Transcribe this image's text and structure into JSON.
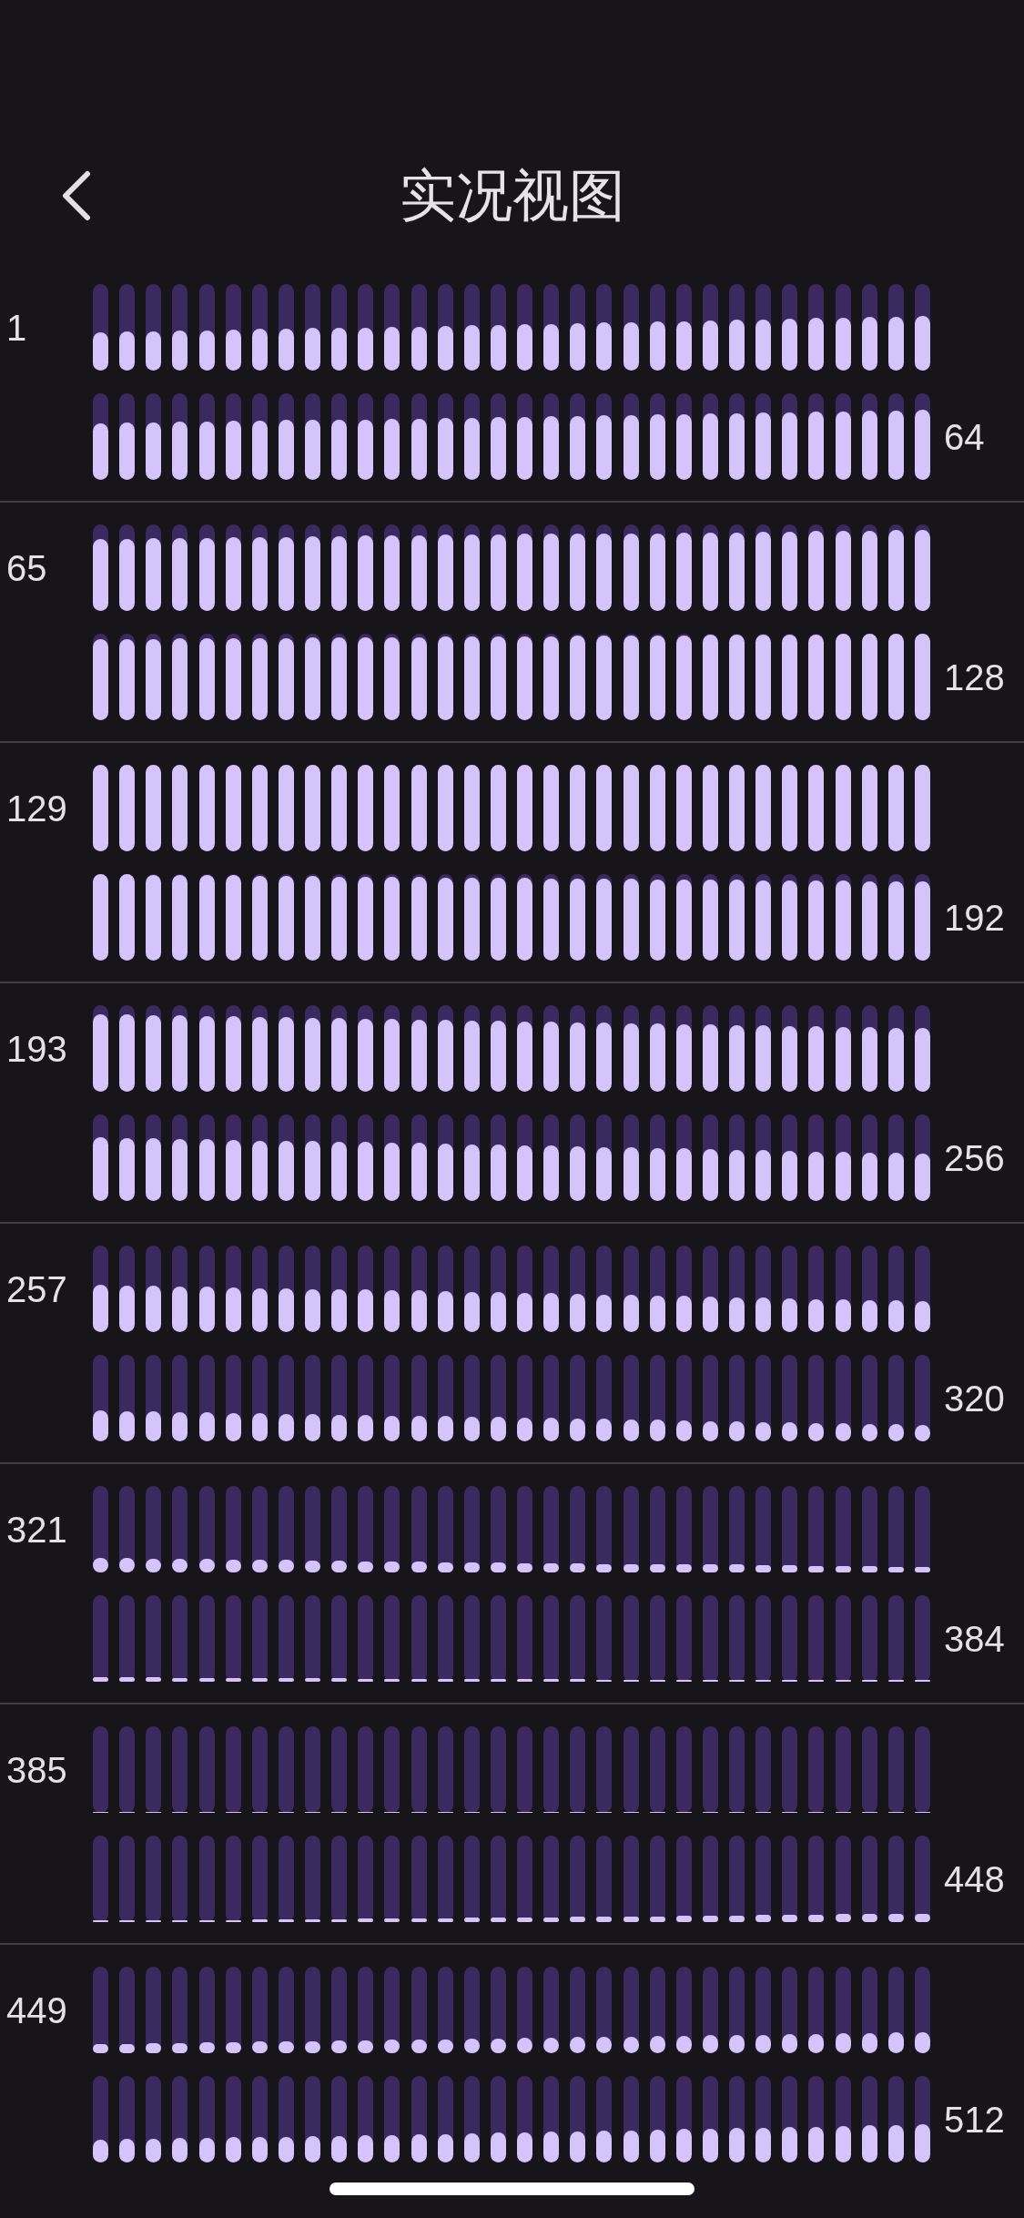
{
  "header": {
    "title": "实况视图"
  },
  "groups": [
    {
      "start": "1",
      "end": "64",
      "rows": [
        {
          "meters": [
            {
              "level": 0.44
            },
            {
              "level": 0.45
            },
            {
              "level": 0.45
            },
            {
              "level": 0.46
            },
            {
              "level": 0.46
            },
            {
              "level": 0.47
            },
            {
              "level": 0.48
            },
            {
              "level": 0.48
            },
            {
              "level": 0.49
            },
            {
              "level": 0.5
            },
            {
              "level": 0.5
            },
            {
              "level": 0.51
            },
            {
              "level": 0.51
            },
            {
              "level": 0.52
            },
            {
              "level": 0.53
            },
            {
              "level": 0.53
            },
            {
              "level": 0.54
            },
            {
              "level": 0.54
            },
            {
              "level": 0.55
            },
            {
              "level": 0.56
            },
            {
              "level": 0.56
            },
            {
              "level": 0.57
            },
            {
              "level": 0.57
            },
            {
              "level": 0.58
            },
            {
              "level": 0.59
            },
            {
              "level": 0.59
            },
            {
              "level": 0.6
            },
            {
              "level": 0.61
            },
            {
              "level": 0.61
            },
            {
              "level": 0.62
            },
            {
              "level": 0.62
            },
            {
              "level": 0.63
            }
          ]
        },
        {
          "meters": [
            {
              "level": 0.65
            },
            {
              "level": 0.66
            },
            {
              "level": 0.66
            },
            {
              "level": 0.67
            },
            {
              "level": 0.67
            },
            {
              "level": 0.68
            },
            {
              "level": 0.68
            },
            {
              "level": 0.69
            },
            {
              "level": 0.69
            },
            {
              "level": 0.7
            },
            {
              "level": 0.7
            },
            {
              "level": 0.71
            },
            {
              "level": 0.71
            },
            {
              "level": 0.72
            },
            {
              "level": 0.72
            },
            {
              "level": 0.73
            },
            {
              "level": 0.73
            },
            {
              "level": 0.74
            },
            {
              "level": 0.74
            },
            {
              "level": 0.75
            },
            {
              "level": 0.75
            },
            {
              "level": 0.76
            },
            {
              "level": 0.76
            },
            {
              "level": 0.77
            },
            {
              "level": 0.77
            },
            {
              "level": 0.78
            },
            {
              "level": 0.78
            },
            {
              "level": 0.79
            },
            {
              "level": 0.79
            },
            {
              "level": 0.8
            },
            {
              "level": 0.8
            },
            {
              "level": 0.81
            }
          ]
        }
      ]
    },
    {
      "start": "65",
      "end": "128",
      "rows": [
        {
          "meters": [
            {
              "level": 0.83
            },
            {
              "level": 0.83
            },
            {
              "level": 0.84
            },
            {
              "level": 0.84
            },
            {
              "level": 0.84
            },
            {
              "level": 0.85
            },
            {
              "level": 0.85
            },
            {
              "level": 0.85
            },
            {
              "level": 0.86
            },
            {
              "level": 0.86
            },
            {
              "level": 0.87
            },
            {
              "level": 0.87
            },
            {
              "level": 0.87
            },
            {
              "level": 0.88
            },
            {
              "level": 0.88
            },
            {
              "level": 0.88
            },
            {
              "level": 0.89
            },
            {
              "level": 0.89
            },
            {
              "level": 0.89
            },
            {
              "level": 0.9
            },
            {
              "level": 0.9
            },
            {
              "level": 0.9
            },
            {
              "level": 0.91
            },
            {
              "level": 0.91
            },
            {
              "level": 0.91
            },
            {
              "level": 0.92
            },
            {
              "level": 0.92
            },
            {
              "level": 0.93
            },
            {
              "level": 0.93
            },
            {
              "level": 0.93
            },
            {
              "level": 0.94
            },
            {
              "level": 0.94
            }
          ]
        },
        {
          "meters": [
            {
              "level": 0.94
            },
            {
              "level": 0.94
            },
            {
              "level": 0.94
            },
            {
              "level": 0.95
            },
            {
              "level": 0.95
            },
            {
              "level": 0.95
            },
            {
              "level": 0.95
            },
            {
              "level": 0.95
            },
            {
              "level": 0.96
            },
            {
              "level": 0.96
            },
            {
              "level": 0.96
            },
            {
              "level": 0.96
            },
            {
              "level": 0.96
            },
            {
              "level": 0.97
            },
            {
              "level": 0.97
            },
            {
              "level": 0.97
            },
            {
              "level": 0.97
            },
            {
              "level": 0.97
            },
            {
              "level": 0.98
            },
            {
              "level": 0.98
            },
            {
              "level": 0.98
            },
            {
              "level": 0.98
            },
            {
              "level": 0.98
            },
            {
              "level": 0.99
            },
            {
              "level": 0.99
            },
            {
              "level": 0.99
            },
            {
              "level": 0.99
            },
            {
              "level": 0.99
            },
            {
              "level": 1
            },
            {
              "level": 1
            },
            {
              "level": 1
            },
            {
              "level": 1
            }
          ]
        }
      ]
    },
    {
      "start": "129",
      "end": "192",
      "rows": [
        {
          "meters": [
            {
              "level": 1
            },
            {
              "level": 1
            },
            {
              "level": 1
            },
            {
              "level": 1
            },
            {
              "level": 1
            },
            {
              "level": 1
            },
            {
              "level": 1
            },
            {
              "level": 1
            },
            {
              "level": 1
            },
            {
              "level": 1
            },
            {
              "level": 1
            },
            {
              "level": 1
            },
            {
              "level": 1
            },
            {
              "level": 1
            },
            {
              "level": 1
            },
            {
              "level": 1
            },
            {
              "level": 1
            },
            {
              "level": 1
            },
            {
              "level": 1
            },
            {
              "level": 1
            },
            {
              "level": 1
            },
            {
              "level": 1
            },
            {
              "level": 1
            },
            {
              "level": 1
            },
            {
              "level": 1
            },
            {
              "level": 1
            },
            {
              "level": 1
            },
            {
              "level": 1
            },
            {
              "level": 1
            },
            {
              "level": 1
            },
            {
              "level": 1
            },
            {
              "level": 1
            }
          ]
        },
        {
          "meters": [
            {
              "level": 1
            },
            {
              "level": 1
            },
            {
              "level": 0.99
            },
            {
              "level": 0.99
            },
            {
              "level": 0.99
            },
            {
              "level": 0.99
            },
            {
              "level": 0.98
            },
            {
              "level": 0.98
            },
            {
              "level": 0.98
            },
            {
              "level": 0.97
            },
            {
              "level": 0.97
            },
            {
              "level": 0.97
            },
            {
              "level": 0.97
            },
            {
              "level": 0.96
            },
            {
              "level": 0.96
            },
            {
              "level": 0.96
            },
            {
              "level": 0.96
            },
            {
              "level": 0.95
            },
            {
              "level": 0.95
            },
            {
              "level": 0.95
            },
            {
              "level": 0.95
            },
            {
              "level": 0.94
            },
            {
              "level": 0.94
            },
            {
              "level": 0.94
            },
            {
              "level": 0.94
            },
            {
              "level": 0.93
            },
            {
              "level": 0.93
            },
            {
              "level": 0.93
            },
            {
              "level": 0.93
            },
            {
              "level": 0.92
            },
            {
              "level": 0.92
            },
            {
              "level": 0.92
            }
          ]
        }
      ]
    },
    {
      "start": "193",
      "end": "256",
      "rows": [
        {
          "meters": [
            {
              "level": 0.89
            },
            {
              "level": 0.89
            },
            {
              "level": 0.88
            },
            {
              "level": 0.88
            },
            {
              "level": 0.87
            },
            {
              "level": 0.87
            },
            {
              "level": 0.86
            },
            {
              "level": 0.86
            },
            {
              "level": 0.85
            },
            {
              "level": 0.85
            },
            {
              "level": 0.84
            },
            {
              "level": 0.84
            },
            {
              "level": 0.83
            },
            {
              "level": 0.83
            },
            {
              "level": 0.82
            },
            {
              "level": 0.82
            },
            {
              "level": 0.81
            },
            {
              "level": 0.81
            },
            {
              "level": 0.8
            },
            {
              "level": 0.8
            },
            {
              "level": 0.79
            },
            {
              "level": 0.79
            },
            {
              "level": 0.78
            },
            {
              "level": 0.78
            },
            {
              "level": 0.77
            },
            {
              "level": 0.77
            },
            {
              "level": 0.76
            },
            {
              "level": 0.76
            },
            {
              "level": 0.75
            },
            {
              "level": 0.75
            },
            {
              "level": 0.74
            },
            {
              "level": 0.74
            }
          ]
        },
        {
          "meters": [
            {
              "level": 0.74
            },
            {
              "level": 0.73
            },
            {
              "level": 0.73
            },
            {
              "level": 0.72
            },
            {
              "level": 0.72
            },
            {
              "level": 0.71
            },
            {
              "level": 0.7
            },
            {
              "level": 0.7
            },
            {
              "level": 0.69
            },
            {
              "level": 0.68
            },
            {
              "level": 0.68
            },
            {
              "level": 0.67
            },
            {
              "level": 0.67
            },
            {
              "level": 0.66
            },
            {
              "level": 0.65
            },
            {
              "level": 0.65
            },
            {
              "level": 0.64
            },
            {
              "level": 0.64
            },
            {
              "level": 0.63
            },
            {
              "level": 0.62
            },
            {
              "level": 0.62
            },
            {
              "level": 0.61
            },
            {
              "level": 0.61
            },
            {
              "level": 0.6
            },
            {
              "level": 0.59
            },
            {
              "level": 0.59
            },
            {
              "level": 0.58
            },
            {
              "level": 0.57
            },
            {
              "level": 0.57
            },
            {
              "level": 0.56
            },
            {
              "level": 0.56
            },
            {
              "level": 0.55
            }
          ]
        }
      ]
    },
    {
      "start": "257",
      "end": "320",
      "rows": [
        {
          "meters": [
            {
              "level": 0.55
            },
            {
              "level": 0.54
            },
            {
              "level": 0.54
            },
            {
              "level": 0.53
            },
            {
              "level": 0.53
            },
            {
              "level": 0.52
            },
            {
              "level": 0.51
            },
            {
              "level": 0.51
            },
            {
              "level": 0.5
            },
            {
              "level": 0.49
            },
            {
              "level": 0.49
            },
            {
              "level": 0.48
            },
            {
              "level": 0.48
            },
            {
              "level": 0.47
            },
            {
              "level": 0.46
            },
            {
              "level": 0.46
            },
            {
              "level": 0.45
            },
            {
              "level": 0.45
            },
            {
              "level": 0.44
            },
            {
              "level": 0.43
            },
            {
              "level": 0.43
            },
            {
              "level": 0.42
            },
            {
              "level": 0.42
            },
            {
              "level": 0.41
            },
            {
              "level": 0.4
            },
            {
              "level": 0.4
            },
            {
              "level": 0.39
            },
            {
              "level": 0.38
            },
            {
              "level": 0.38
            },
            {
              "level": 0.37
            },
            {
              "level": 0.37
            },
            {
              "level": 0.36
            }
          ]
        },
        {
          "meters": [
            {
              "level": 0.36
            },
            {
              "level": 0.35
            },
            {
              "level": 0.35
            },
            {
              "level": 0.34
            },
            {
              "level": 0.34
            },
            {
              "level": 0.33
            },
            {
              "level": 0.33
            },
            {
              "level": 0.32
            },
            {
              "level": 0.32
            },
            {
              "level": 0.31
            },
            {
              "level": 0.31
            },
            {
              "level": 0.3
            },
            {
              "level": 0.29
            },
            {
              "level": 0.29
            },
            {
              "level": 0.28
            },
            {
              "level": 0.28
            },
            {
              "level": 0.27
            },
            {
              "level": 0.27
            },
            {
              "level": 0.26
            },
            {
              "level": 0.26
            },
            {
              "level": 0.25
            },
            {
              "level": 0.25
            },
            {
              "level": 0.24
            },
            {
              "level": 0.23
            },
            {
              "level": 0.23
            },
            {
              "level": 0.22
            },
            {
              "level": 0.22
            },
            {
              "level": 0.21
            },
            {
              "level": 0.21
            },
            {
              "level": 0.2
            },
            {
              "level": 0.2
            },
            {
              "level": 0.19
            }
          ]
        }
      ]
    },
    {
      "start": "321",
      "end": "384",
      "rows": [
        {
          "meters": [
            {
              "level": 0.17
            },
            {
              "level": 0.17
            },
            {
              "level": 0.16
            },
            {
              "level": 0.16
            },
            {
              "level": 0.16
            },
            {
              "level": 0.15
            },
            {
              "level": 0.15
            },
            {
              "level": 0.15
            },
            {
              "level": 0.14
            },
            {
              "level": 0.14
            },
            {
              "level": 0.13
            },
            {
              "level": 0.13
            },
            {
              "level": 0.13
            },
            {
              "level": 0.12
            },
            {
              "level": 0.12
            },
            {
              "level": 0.12
            },
            {
              "level": 0.11
            },
            {
              "level": 0.11
            },
            {
              "level": 0.11
            },
            {
              "level": 0.1
            },
            {
              "level": 0.1
            },
            {
              "level": 0.1
            },
            {
              "level": 0.09
            },
            {
              "level": 0.09
            },
            {
              "level": 0.09
            },
            {
              "level": 0.08
            },
            {
              "level": 0.08
            },
            {
              "level": 0.07
            },
            {
              "level": 0.07
            },
            {
              "level": 0.07
            },
            {
              "level": 0.06
            },
            {
              "level": 0.06
            }
          ]
        },
        {
          "meters": [
            {
              "level": 0.05
            },
            {
              "level": 0.05
            },
            {
              "level": 0.05
            },
            {
              "level": 0.045
            },
            {
              "level": 0.045
            },
            {
              "level": 0.045
            },
            {
              "level": 0.04
            },
            {
              "level": 0.04
            },
            {
              "level": 0.04
            },
            {
              "level": 0.04
            },
            {
              "level": 0.035
            },
            {
              "level": 0.035
            },
            {
              "level": 0.035
            },
            {
              "level": 0.035
            },
            {
              "level": 0.03
            },
            {
              "level": 0.03
            },
            {
              "level": 0.03
            },
            {
              "level": 0.03
            },
            {
              "level": 0.03
            },
            {
              "level": 0.025
            },
            {
              "level": 0.025
            },
            {
              "level": 0.025
            },
            {
              "level": 0.025
            },
            {
              "level": 0.025
            },
            {
              "level": 0.025
            },
            {
              "level": 0.02
            },
            {
              "level": 0.02
            },
            {
              "level": 0.02
            },
            {
              "level": 0.02
            },
            {
              "level": 0.02
            },
            {
              "level": 0.02
            },
            {
              "level": 0.02
            }
          ]
        }
      ]
    },
    {
      "start": "385",
      "end": "448",
      "rows": [
        {
          "meters": [
            {
              "level": 0
            },
            {
              "level": 0
            },
            {
              "level": 0
            },
            {
              "level": 0
            },
            {
              "level": 0
            },
            {
              "level": 0
            },
            {
              "level": 0
            },
            {
              "level": 0
            },
            {
              "level": 0
            },
            {
              "level": 0
            },
            {
              "level": 0
            },
            {
              "level": 0
            },
            {
              "level": 0
            },
            {
              "level": 0
            },
            {
              "level": 0
            },
            {
              "level": 0
            },
            {
              "level": 0
            },
            {
              "level": 0
            },
            {
              "level": 0
            },
            {
              "level": 0
            },
            {
              "level": 0.015
            },
            {
              "level": 0.015
            },
            {
              "level": 0.015
            },
            {
              "level": 0.015
            },
            {
              "level": 0.015
            },
            {
              "level": 0.015
            },
            {
              "level": 0.015
            },
            {
              "level": 0.015
            },
            {
              "level": 0.015
            },
            {
              "level": 0.015
            },
            {
              "level": 0.015
            },
            {
              "level": 0.015
            }
          ]
        },
        {
          "meters": [
            {
              "level": 0.02
            },
            {
              "level": 0.02
            },
            {
              "level": 0.02
            },
            {
              "level": 0.025
            },
            {
              "level": 0.025
            },
            {
              "level": 0.025
            },
            {
              "level": 0.03
            },
            {
              "level": 0.03
            },
            {
              "level": 0.035
            },
            {
              "level": 0.035
            },
            {
              "level": 0.04
            },
            {
              "level": 0.04
            },
            {
              "level": 0.045
            },
            {
              "level": 0.045
            },
            {
              "level": 0.05
            },
            {
              "level": 0.05
            },
            {
              "level": 0.055
            },
            {
              "level": 0.055
            },
            {
              "level": 0.06
            },
            {
              "level": 0.06
            },
            {
              "level": 0.065
            },
            {
              "level": 0.065
            },
            {
              "level": 0.07
            },
            {
              "level": 0.07
            },
            {
              "level": 0.075
            },
            {
              "level": 0.08
            },
            {
              "level": 0.08
            },
            {
              "level": 0.085
            },
            {
              "level": 0.09
            },
            {
              "level": 0.09
            },
            {
              "level": 0.095
            },
            {
              "level": 0.1
            }
          ]
        }
      ]
    },
    {
      "start": "449",
      "end": "512",
      "rows": [
        {
          "meters": [
            {
              "level": 0.11
            },
            {
              "level": 0.11
            },
            {
              "level": 0.12
            },
            {
              "level": 0.12
            },
            {
              "level": 0.13
            },
            {
              "level": 0.13
            },
            {
              "level": 0.14
            },
            {
              "level": 0.14
            },
            {
              "level": 0.14
            },
            {
              "level": 0.15
            },
            {
              "level": 0.15
            },
            {
              "level": 0.16
            },
            {
              "level": 0.16
            },
            {
              "level": 0.16
            },
            {
              "level": 0.17
            },
            {
              "level": 0.17
            },
            {
              "level": 0.18
            },
            {
              "level": 0.18
            },
            {
              "level": 0.19
            },
            {
              "level": 0.19
            },
            {
              "level": 0.19
            },
            {
              "level": 0.2
            },
            {
              "level": 0.2
            },
            {
              "level": 0.21
            },
            {
              "level": 0.21
            },
            {
              "level": 0.21
            },
            {
              "level": 0.22
            },
            {
              "level": 0.22
            },
            {
              "level": 0.23
            },
            {
              "level": 0.23
            },
            {
              "level": 0.24
            },
            {
              "level": 0.24
            }
          ]
        },
        {
          "meters": [
            {
              "level": 0.26
            },
            {
              "level": 0.27
            },
            {
              "level": 0.27
            },
            {
              "level": 0.28
            },
            {
              "level": 0.28
            },
            {
              "level": 0.29
            },
            {
              "level": 0.29
            },
            {
              "level": 0.3
            },
            {
              "level": 0.31
            },
            {
              "level": 0.31
            },
            {
              "level": 0.32
            },
            {
              "level": 0.32
            },
            {
              "level": 0.33
            },
            {
              "level": 0.33
            },
            {
              "level": 0.34
            },
            {
              "level": 0.35
            },
            {
              "level": 0.35
            },
            {
              "level": 0.36
            },
            {
              "level": 0.36
            },
            {
              "level": 0.37
            },
            {
              "level": 0.37
            },
            {
              "level": 0.38
            },
            {
              "level": 0.39
            },
            {
              "level": 0.39
            },
            {
              "level": 0.4
            },
            {
              "level": 0.4
            },
            {
              "level": 0.41
            },
            {
              "level": 0.41
            },
            {
              "level": 0.42
            },
            {
              "level": 0.43
            },
            {
              "level": 0.43
            },
            {
              "level": 0.44
            }
          ]
        }
      ]
    }
  ]
}
